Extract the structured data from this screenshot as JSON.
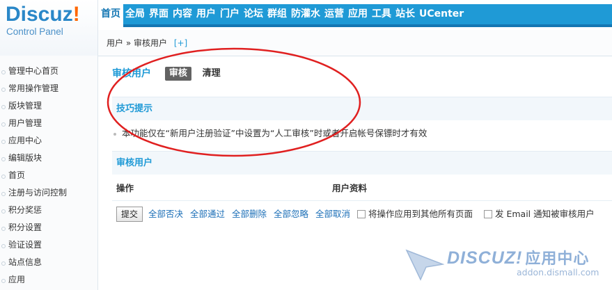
{
  "logo": {
    "brand": "Discuz",
    "brand_excl": "!",
    "sub": "Control Panel"
  },
  "topnav": [
    "首页",
    "全局",
    "界面",
    "内容",
    "用户",
    "门户",
    "论坛",
    "群组",
    "防灌水",
    "运营",
    "应用",
    "工具",
    "站长",
    "UCenter"
  ],
  "breadcrumb": {
    "path": "用户 » 审核用户",
    "plus": "[+]"
  },
  "sidebar": [
    "管理中心首页",
    "常用操作管理",
    "版块管理",
    "用户管理",
    "应用中心",
    "编辑版块",
    "首页",
    "注册与访问控制",
    "积分奖惩",
    "积分设置",
    "验证设置",
    "站点信息",
    "应用"
  ],
  "page": {
    "title": "审核用户",
    "tab_audit": "审核",
    "tab_clean": "清理"
  },
  "tips": {
    "heading": "技巧提示",
    "text": "本功能仅在“新用户注册验证”中设置为“人工审核”时或者开启帐号保镖时才有效"
  },
  "audit_section": {
    "heading": "审核用户",
    "col_action": "操作",
    "col_profile": "用户资料"
  },
  "actions": {
    "submit": "提交",
    "reject_all": "全部否决",
    "pass_all": "全部通过",
    "delete_all": "全部删除",
    "ignore_all": "全部忽略",
    "cancel_all": "全部取消",
    "apply_other_pages": "将操作应用到其他所有页面",
    "send_email": "发 Email 通知被审核用户"
  },
  "watermark": {
    "word": "DISCUZ!",
    "zh": "应用中心",
    "url": "addon.dismall.com"
  },
  "colors": {
    "accent": "#1f9ad6",
    "annotation": "#e02020"
  }
}
